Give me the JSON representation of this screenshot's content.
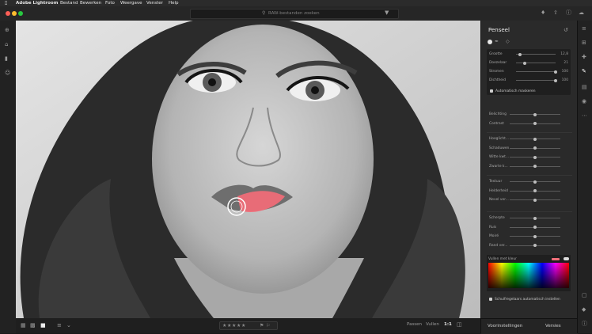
{
  "menubar": {
    "apple": "",
    "app": "Adobe Lightroom",
    "items": [
      "Bestand",
      "Bewerken",
      "Foto",
      "Weergave",
      "Venster",
      "Help"
    ]
  },
  "search": {
    "placeholder": "RAW-bestanden zoeken"
  },
  "panel": {
    "title": "Penseel",
    "brush_controls": [
      {
        "label": "Grootte",
        "value": "12,8",
        "fraction": 0.1
      },
      {
        "label": "Doezelaar",
        "value": "21",
        "fraction": 0.21
      },
      {
        "label": "Stromen",
        "value": "100",
        "fraction": 1.0
      },
      {
        "label": "Dichtheid",
        "value": "100",
        "fraction": 1.0
      }
    ],
    "auto_mask": {
      "label": "Automatisch maskeren",
      "checked": true
    },
    "adjustment_groups": [
      [
        "Belichting",
        "Contrast"
      ],
      [
        "Hooglicht...",
        "Schaduwen",
        "Witte kwt...",
        "Zwarte k..."
      ],
      [
        "Textuur",
        "Helderheid",
        "Nevel ver..."
      ],
      [
        "Scherpte",
        "Ruis",
        "Moiré",
        "Rand ver..."
      ]
    ],
    "color": {
      "label": "Vullen met kleur",
      "accent": "#f0707a"
    },
    "auto_straighten": {
      "label": "Schuifregelaars automatisch instellen",
      "checked": true
    }
  },
  "bottombar": {
    "rating_stars": 5,
    "fit_label": "Passen",
    "fill_label": "Vullen",
    "zoom_label": "1:1",
    "presets_label": "Voorinstellingen",
    "versions_label": "Versies"
  }
}
